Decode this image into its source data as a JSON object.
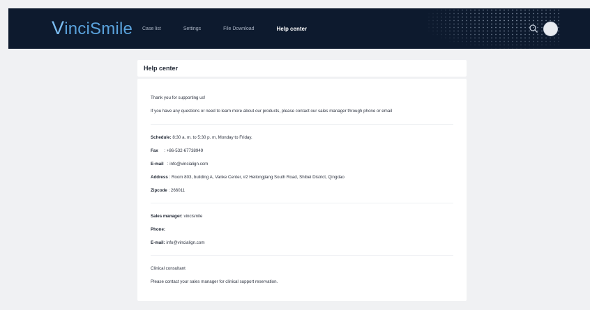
{
  "header": {
    "logo_prefix": "V",
    "logo_rest": "inciSmile",
    "nav": [
      "Case list",
      "Settings",
      "File Download",
      "Help center"
    ],
    "active_nav": "Help center"
  },
  "page_title": "Help center",
  "intro": {
    "thanks": "Thank you for supporting us!",
    "message": "If you have any questions or need to learn more about our products, please contact our sales manager through phone or email"
  },
  "company": {
    "schedule_label": "Schedule:",
    "schedule_value": "8:30 a. m. to 5:30 p. m, Monday to Friday.",
    "fax_label": "Fax",
    "fax_value": ": +86-532-67738949",
    "email_label": "E-mail",
    "email_value": ": info@vincialign.com",
    "address_label": "Address",
    "address_value": ": Room 803, building A, Vanke Center, #2 Heilongjiang South Road, Shibei District, Qingdao",
    "zipcode_label": "Zipcode",
    "zipcode_value": ": 266011"
  },
  "sales": {
    "manager_label": "Sales manager:",
    "manager_value": "vincismile",
    "phone_label": "Phone:",
    "email_label": "E-mail:",
    "email_value": "info@vincialign.com"
  },
  "clinical": {
    "heading": "Clinical consultant",
    "text": "Please contact your sales manager for clinical support reservation."
  },
  "colors": {
    "header_bg": "#0d1a2e",
    "logo": "#5aa2dc",
    "page_bg": "#f0f1f3"
  }
}
